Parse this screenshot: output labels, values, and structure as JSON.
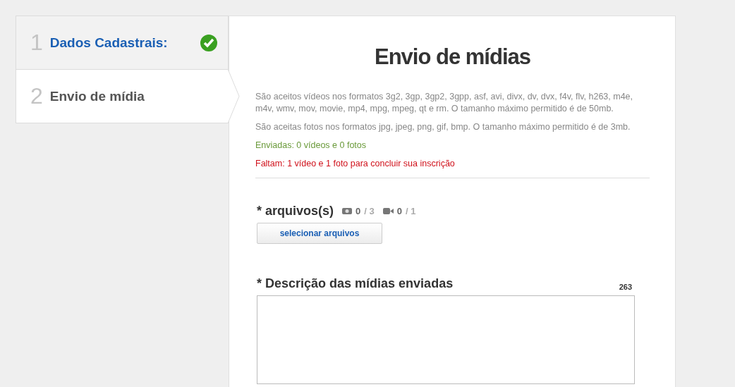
{
  "steps": [
    {
      "number": "1",
      "label": "Dados Cadastrais:",
      "selected": false,
      "completed": true
    },
    {
      "number": "2",
      "label": "Envio de mídia",
      "selected": true,
      "completed": false
    }
  ],
  "title": "Envio de mídias",
  "info": [
    {
      "kind": "note",
      "text": "São aceitos vídeos nos formatos 3g2, 3gp, 3gp2, 3gpp, asf, avi, divx, dv, dvx, f4v, flv, h263, m4e, m4v, wmv, mov, movie, mp4, mpg, mpeg, qt e rm. O tamanho máximo permitido é de 50mb."
    },
    {
      "kind": "note",
      "text": "São aceitas fotos nos formatos jpg, jpeg, png, gif, bmp. O tamanho máximo permitido é de 3mb."
    },
    {
      "kind": "success",
      "text": "Enviadas: 0 vídeos e 0 fotos"
    },
    {
      "kind": "error",
      "text": "Faltam: 1 vídeo e 1 foto para concluir sua inscrição"
    }
  ],
  "files": {
    "label": "* arquivos(s)",
    "counters": [
      {
        "kind": "photo",
        "count": "0",
        "limit": "/ 3"
      },
      {
        "kind": "video",
        "count": "0",
        "limit": "/ 1"
      }
    ],
    "button": "selecionar arquivos"
  },
  "description": {
    "label": "* Descrição das mídias enviadas",
    "remaining": "263"
  }
}
